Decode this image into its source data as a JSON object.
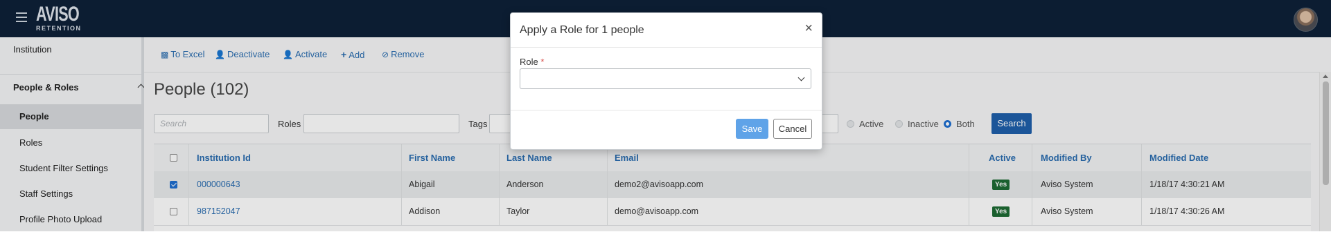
{
  "header": {
    "logo_main": "AVISO",
    "logo_sub": "RETENTION"
  },
  "sidebar": {
    "items": [
      {
        "label": "Institution"
      },
      {
        "label": "People & Roles"
      },
      {
        "label": "People"
      },
      {
        "label": "Roles"
      },
      {
        "label": "Student Filter Settings"
      },
      {
        "label": "Staff Settings"
      },
      {
        "label": "Profile Photo Upload"
      }
    ]
  },
  "toolbar": {
    "to_excel": "To Excel",
    "deactivate": "Deactivate",
    "activate": "Activate",
    "add": "Add",
    "remove": "Remove"
  },
  "main": {
    "title": "People (102)"
  },
  "filters": {
    "search_placeholder": "Search",
    "roles_label": "Roles",
    "tags_label": "Tags",
    "status_options": [
      {
        "label": "Active",
        "selected": false
      },
      {
        "label": "Inactive",
        "selected": false
      },
      {
        "label": "Both",
        "selected": true
      }
    ],
    "search_button": "Search"
  },
  "table": {
    "columns": [
      "Institution Id",
      "First Name",
      "Last Name",
      "Email",
      "Active",
      "Modified By",
      "Modified Date"
    ],
    "rows": [
      {
        "checked": true,
        "institution_id": "000000643",
        "first_name": "Abigail",
        "last_name": "Anderson",
        "email": "demo2@avisoapp.com",
        "active": "Yes",
        "modified_by": "Aviso System",
        "modified_date": "1/18/17 4:30:21 AM"
      },
      {
        "checked": false,
        "institution_id": "987152047",
        "first_name": "Addison",
        "last_name": "Taylor",
        "email": "demo@avisoapp.com",
        "active": "Yes",
        "modified_by": "Aviso System",
        "modified_date": "1/18/17 4:30:26 AM"
      }
    ]
  },
  "modal": {
    "title": "Apply a Role for 1 people",
    "close": "×",
    "role_label": "Role",
    "required_marker": "*",
    "role_value": "",
    "save_label": "Save",
    "cancel_label": "Cancel"
  },
  "colors": {
    "topbar": "#0e2138",
    "link": "#2a6db0",
    "primary_button": "#1f5fab",
    "active_badge": "#1e6b34",
    "save_button": "#5fa3e8"
  }
}
